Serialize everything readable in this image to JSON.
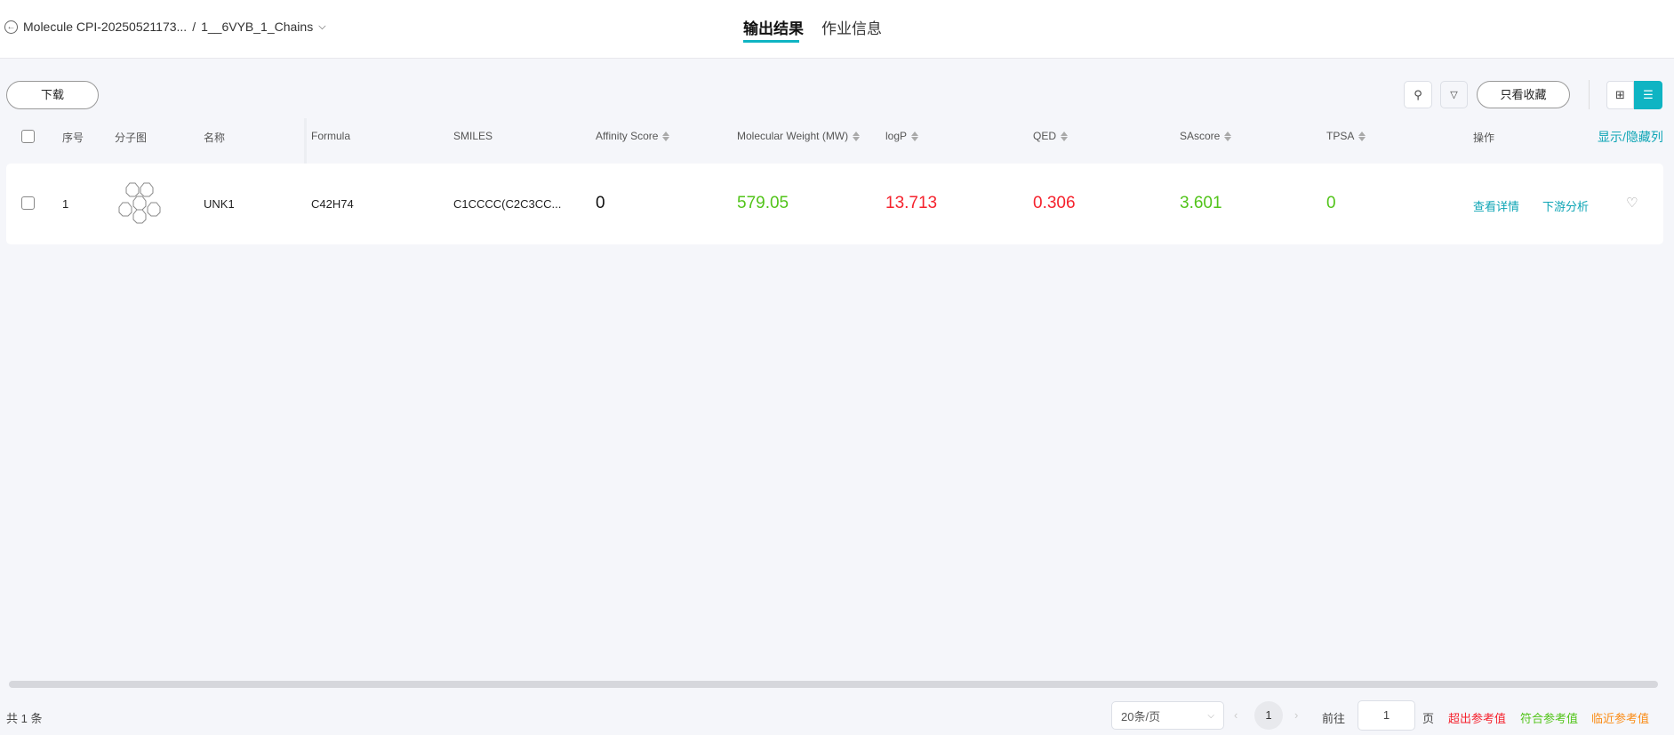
{
  "header": {
    "breadcrumb_project": "Molecule CPI-20250521173...",
    "breadcrumb_sep": "/",
    "breadcrumb_item": "1__6VYB_1_Chains",
    "tabs": [
      {
        "label": "输出结果",
        "active": true
      },
      {
        "label": "作业信息",
        "active": false
      }
    ]
  },
  "toolbar": {
    "download": "下载",
    "favorites_only": "只看收藏",
    "show_hide_columns": "显示/隐藏列"
  },
  "table": {
    "columns": [
      "序号",
      "分子图",
      "名称",
      "Formula",
      "SMILES",
      "Affinity Score",
      "Molecular Weight (MW)",
      "logP",
      "QED",
      "SAscore",
      "TPSA",
      "操作"
    ],
    "rows": [
      {
        "index": "1",
        "name": "UNK1",
        "formula": "C42H74",
        "smiles": "C1CCCC(C2C3CC...",
        "affinity": "0",
        "mw": "579.05",
        "logp": "13.713",
        "qed": "0.306",
        "sascore": "3.601",
        "tpsa": "0",
        "action_detail": "查看详情",
        "action_downstream": "下游分析"
      }
    ]
  },
  "footer": {
    "total": "共 1 条",
    "page_size": "20条/页",
    "current_page": "1",
    "goto_label": "前往",
    "goto_value": "1",
    "page_suffix": "页",
    "legend": [
      "超出参考值",
      "符合参考值",
      "临近参考值"
    ]
  },
  "colors": {
    "accent": "#0fb4c3",
    "exceed": "#f5222d",
    "match": "#52c41a",
    "near": "#fa8c16"
  }
}
